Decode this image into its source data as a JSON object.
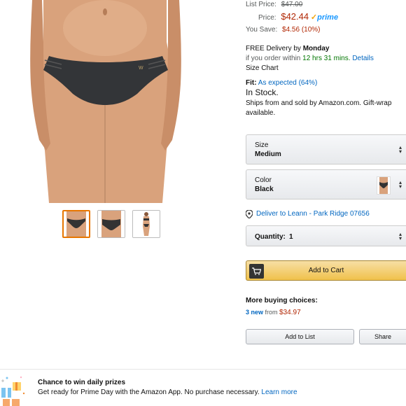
{
  "pricing": {
    "list_price_label": "List Price:",
    "list_price": "$47.00",
    "price_label": "Price:",
    "price": "$42.44",
    "prime_check": "✓",
    "prime_word": "prime",
    "you_save_label": "You Save:",
    "you_save": "$4.56 (10%)"
  },
  "delivery": {
    "free_delivery_prefix": "FREE Delivery by",
    "delivery_day": "Monday",
    "order_within_prefix": "if you order within",
    "countdown": "12 hrs 31 mins.",
    "details_link": "Details",
    "size_chart_link": "Size Chart"
  },
  "fit": {
    "label": "Fit:",
    "value": "As expected (64%)"
  },
  "stock_status": "In Stock.",
  "ships_from": "Ships from and sold by Amazon.com. Gift-wrap",
  "ships_from_cont": "available.",
  "size_select": {
    "label": "Size",
    "value": "Medium"
  },
  "color_select": {
    "label": "Color",
    "value": "Black"
  },
  "deliver_to": "Deliver to Leann - Park Ridge 07656",
  "quantity_select": {
    "label": "Quantity:",
    "value": "1"
  },
  "add_to_cart": "Add to Cart",
  "more_buying": {
    "title": "More buying choices:",
    "new_count": "3 new",
    "from_text": "from",
    "from_price": "$34.97"
  },
  "add_to_list": "Add to List",
  "share": "Share",
  "promo": {
    "title": "Chance to win daily prizes",
    "text": "Get ready for Prime Day with the Amazon App. No purchase necessary.",
    "link": "Learn more"
  },
  "colors": {
    "price_red": "#B12704",
    "link_blue": "#0066c0",
    "stock_green": "#007600",
    "cart_yellow": "#f0c14b",
    "selected_thumb": "#e77600"
  }
}
